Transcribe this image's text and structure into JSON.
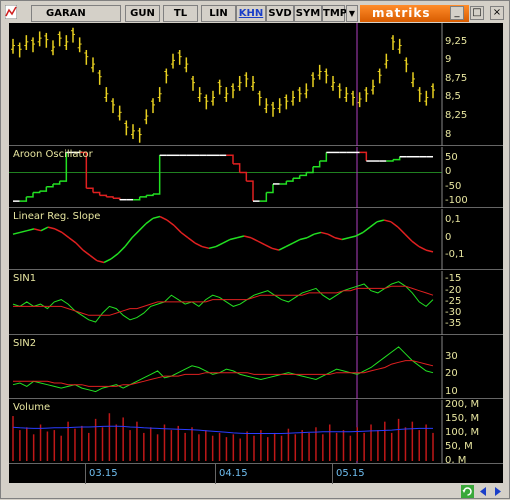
{
  "toolbar": {
    "symbol": "GARAN",
    "buttons": [
      "GUN",
      "TL",
      "LIN",
      "KHN",
      "SVD",
      "SYM",
      "TMP",
      "▼"
    ],
    "active": "KHN",
    "logo": "matriks"
  },
  "window": {
    "min": "_",
    "max": "□",
    "close": "×"
  },
  "panels": {
    "price": {
      "title": "",
      "ticks": [
        "9,25",
        "9",
        "8,75",
        "8,5",
        "8,25",
        "8"
      ]
    },
    "aroon": {
      "title": "Aroon Oscillator",
      "ticks": [
        "50",
        "0",
        "-50",
        "-100"
      ]
    },
    "linreg": {
      "title": "Linear Reg. Slope",
      "ticks": [
        "0,1",
        "0",
        "-0,1"
      ]
    },
    "sin1": {
      "title": "SIN1",
      "ticks": [
        "-15",
        "-20",
        "-25",
        "-30",
        "-35"
      ]
    },
    "sin2": {
      "title": "SIN2",
      "ticks": [
        "30",
        "20",
        "10"
      ]
    },
    "volume": {
      "title": "Volume",
      "ticks": [
        "200, M",
        "150, M",
        "100, M",
        "50, M",
        "0, M"
      ]
    }
  },
  "dates": [
    "03.15",
    "04.15",
    "05.15"
  ],
  "colors": {
    "accent_green": "#22e022",
    "accent_red": "#e02020",
    "bar_yellow": "#e8d020",
    "axis_text": "#e8e6a0",
    "date_text": "#6fbef0",
    "cursor": "#b040c0"
  },
  "chart_data": {
    "type": "line",
    "price_close": [
      9.2,
      9.15,
      9.25,
      9.22,
      9.3,
      9.28,
      9.18,
      9.3,
      9.25,
      9.35,
      9.22,
      9.05,
      8.95,
      8.78,
      8.55,
      8.4,
      8.3,
      8.1,
      8.05,
      8.0,
      8.25,
      8.4,
      8.55,
      8.8,
      9.0,
      9.05,
      8.95,
      8.7,
      8.55,
      8.45,
      8.5,
      8.65,
      8.55,
      8.6,
      8.7,
      8.75,
      8.7,
      8.5,
      8.4,
      8.35,
      8.4,
      8.45,
      8.5,
      8.55,
      8.6,
      8.75,
      8.85,
      8.8,
      8.7,
      8.6,
      8.55,
      8.5,
      8.48,
      8.55,
      8.65,
      8.8,
      9.0,
      9.25,
      9.2,
      8.95,
      8.75,
      8.55,
      8.5,
      8.6
    ],
    "aroon": [
      -100,
      -100,
      -85,
      -70,
      -65,
      -50,
      -40,
      -30,
      70,
      70,
      70,
      -55,
      -70,
      -80,
      -85,
      -90,
      -95,
      -95,
      -95,
      -85,
      -80,
      -75,
      60,
      60,
      60,
      60,
      60,
      60,
      60,
      60,
      60,
      60,
      60,
      30,
      0,
      -30,
      -100,
      -100,
      -70,
      -40,
      -40,
      -30,
      -20,
      -10,
      0,
      20,
      40,
      70,
      70,
      70,
      70,
      70,
      70,
      40,
      40,
      40,
      40,
      45,
      55,
      55,
      55,
      55,
      55,
      55
    ],
    "linreg_slope": [
      0.02,
      0.03,
      0.04,
      0.05,
      0.04,
      0.06,
      0.05,
      0.03,
      0.0,
      -0.03,
      -0.07,
      -0.1,
      -0.13,
      -0.14,
      -0.12,
      -0.09,
      -0.05,
      0.0,
      0.04,
      0.08,
      0.11,
      0.12,
      0.1,
      0.07,
      0.03,
      0.0,
      -0.03,
      -0.05,
      -0.06,
      -0.05,
      -0.03,
      -0.01,
      0.0,
      0.01,
      0.0,
      -0.02,
      -0.04,
      -0.06,
      -0.07,
      -0.05,
      -0.03,
      -0.01,
      0.0,
      0.02,
      0.03,
      0.02,
      0.0,
      -0.01,
      0.0,
      0.01,
      0.03,
      0.06,
      0.09,
      0.1,
      0.09,
      0.06,
      0.02,
      -0.02,
      -0.05,
      -0.07,
      -0.08
    ],
    "sin1_fast": [
      -26,
      -27,
      -25,
      -27,
      -26,
      -28,
      -25,
      -24,
      -26,
      -29,
      -31,
      -33,
      -34,
      -30,
      -27,
      -28,
      -31,
      -33,
      -32,
      -30,
      -27,
      -26,
      -25,
      -22,
      -24,
      -26,
      -25,
      -27,
      -24,
      -22,
      -23,
      -25,
      -27,
      -26,
      -24,
      -22,
      -21,
      -20,
      -22,
      -24,
      -25,
      -23,
      -21,
      -20,
      -19,
      -22,
      -24,
      -22,
      -20,
      -19,
      -18,
      -17,
      -20,
      -21,
      -19,
      -17,
      -16,
      -18,
      -21,
      -25,
      -27,
      -24
    ],
    "sin1_slow": [
      -27,
      -27,
      -27,
      -27,
      -27,
      -27,
      -27,
      -27,
      -28,
      -29,
      -30,
      -31,
      -31,
      -31,
      -31,
      -30,
      -29,
      -28,
      -28,
      -27,
      -26,
      -25,
      -25,
      -25,
      -25,
      -25,
      -25,
      -25,
      -25,
      -24,
      -24,
      -24,
      -24,
      -24,
      -24,
      -23,
      -22,
      -22,
      -22,
      -22,
      -22,
      -22,
      -22,
      -21,
      -21,
      -21,
      -21,
      -21,
      -20,
      -20,
      -19,
      -19,
      -19,
      -19,
      -19,
      -18,
      -18,
      -18,
      -19,
      -20,
      -21,
      -22
    ],
    "sin2_fast": [
      14,
      15,
      13,
      16,
      15,
      14,
      13,
      12,
      13,
      14,
      12,
      11,
      10,
      12,
      13,
      14,
      12,
      14,
      16,
      18,
      20,
      22,
      18,
      19,
      21,
      23,
      25,
      24,
      22,
      20,
      21,
      23,
      22,
      20,
      19,
      18,
      17,
      18,
      19,
      20,
      21,
      20,
      19,
      18,
      17,
      19,
      21,
      23,
      22,
      21,
      20,
      22,
      24,
      27,
      30,
      33,
      36,
      32,
      28,
      25,
      22,
      21
    ],
    "sin2_slow": [
      16,
      16,
      16,
      16,
      16,
      16,
      15,
      15,
      14,
      14,
      14,
      13,
      13,
      13,
      13,
      13,
      14,
      14,
      15,
      16,
      17,
      18,
      19,
      19,
      19,
      20,
      20,
      20,
      21,
      21,
      21,
      21,
      21,
      21,
      21,
      20,
      20,
      20,
      20,
      20,
      20,
      20,
      20,
      20,
      20,
      20,
      20,
      21,
      21,
      21,
      21,
      21,
      22,
      23,
      24,
      26,
      27,
      28,
      28,
      27,
      26,
      25
    ],
    "volume": [
      160,
      110,
      120,
      95,
      130,
      105,
      110,
      90,
      140,
      115,
      125,
      100,
      150,
      120,
      170,
      130,
      155,
      110,
      140,
      100,
      120,
      95,
      130,
      110,
      125,
      100,
      120,
      95,
      110,
      90,
      100,
      85,
      95,
      80,
      105,
      90,
      110,
      85,
      100,
      90,
      115,
      95,
      110,
      100,
      120,
      95,
      130,
      100,
      110,
      90,
      120,
      100,
      130,
      110,
      140,
      100,
      150,
      120,
      140,
      110,
      130,
      100
    ],
    "volume_avg": [
      120,
      118,
      117,
      116,
      116,
      117,
      118,
      118,
      119,
      120,
      121,
      121,
      122,
      123,
      124,
      124,
      123,
      121,
      120,
      118,
      117,
      116,
      115,
      114,
      113,
      112,
      111,
      110,
      108,
      106,
      104,
      102,
      100,
      99,
      98,
      98,
      98,
      98,
      98,
      98,
      99,
      100,
      101,
      102,
      103,
      104,
      104,
      104,
      104,
      104,
      105,
      106,
      107,
      108,
      109,
      110,
      112,
      114,
      115,
      116,
      116,
      116
    ],
    "ranges": {
      "price": [
        7.9,
        9.45
      ],
      "aroon": [
        -110,
        75
      ],
      "linreg": [
        -0.16,
        0.14
      ],
      "sin1": [
        -38,
        -13
      ],
      "sin2": [
        8,
        40
      ],
      "volume": [
        0,
        210
      ]
    }
  }
}
